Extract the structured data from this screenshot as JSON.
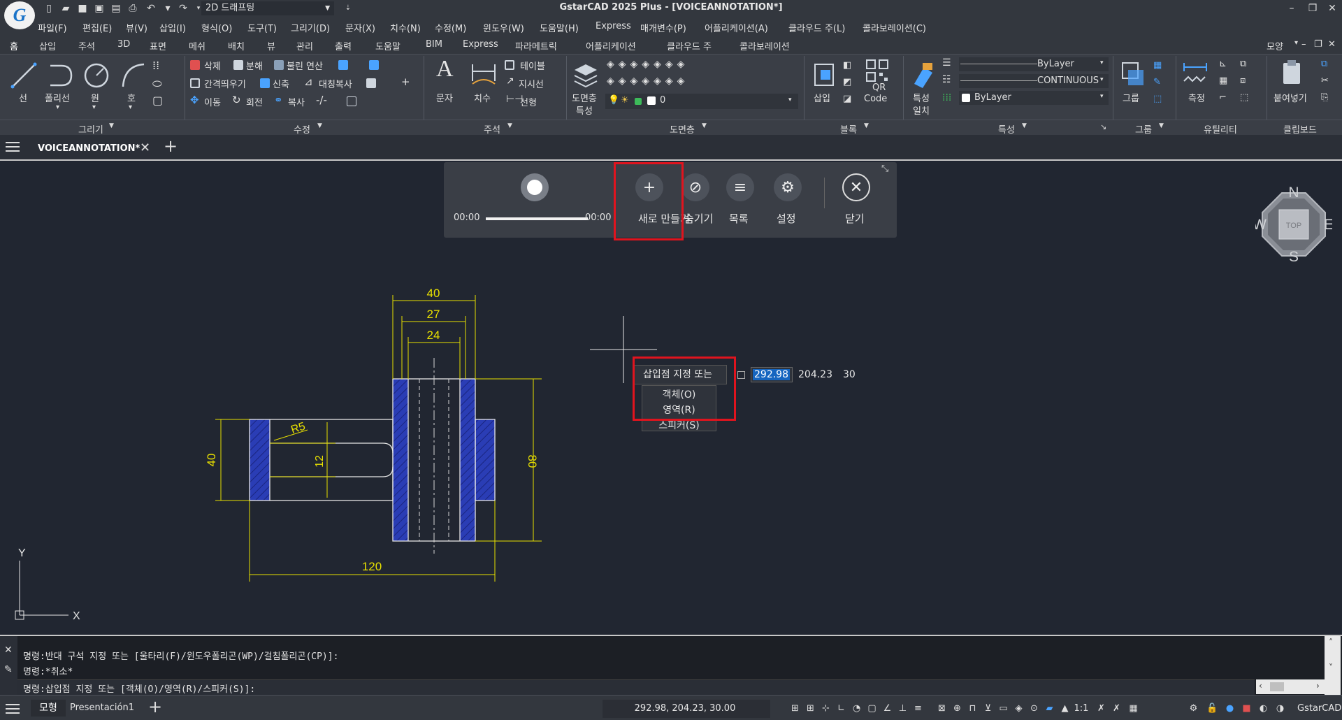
{
  "app": {
    "title": "GstarCAD 2025 Plus - [VOICEANNOTATION*]",
    "logo_letter": "G",
    "workspace": "2D 드래프팅"
  },
  "menu": [
    "파일(F)",
    "편집(E)",
    "뷰(V)",
    "삽입(I)",
    "형식(O)",
    "도구(T)",
    "그리기(D)",
    "문자(X)",
    "치수(N)",
    "수정(M)",
    "윈도우(W)",
    "도움말(H)",
    "Express",
    "매개변수(P)",
    "어플리케이션(A)",
    "클라우드 주(L)",
    "콜라보레이션(C)"
  ],
  "ribbon_tabs": [
    "홈",
    "삽입",
    "주석",
    "3D",
    "표면",
    "메쉬",
    "배치",
    "뷰",
    "관리",
    "출력",
    "도움말",
    "BIM",
    "Express",
    "파라메트릭",
    "어플리케이션",
    "클라우드 주",
    "콜라보레이션"
  ],
  "ribbon_right_label": "모양",
  "ribbon": {
    "draw": {
      "line": "선",
      "polyline": "폴리선",
      "circle": "원",
      "arc": "호",
      "panel": "그리기"
    },
    "modify": {
      "erase": "삭제",
      "explode": "분해",
      "boolean": "불린 연산",
      "offset": "간격띄우기",
      "stretch": "신축",
      "mirror": "대칭복사",
      "move": "이동",
      "rotate": "회전",
      "copy": "복사",
      "panel": "수정"
    },
    "annotation": {
      "text": "문자",
      "dimension": "치수",
      "table": "테이블",
      "leader": "지시선",
      "linear": "선형",
      "panel": "주석"
    },
    "layers": {
      "layer_props_1": "도면층",
      "layer_props_2": "특성",
      "current_layer": "0",
      "panel": "도면층"
    },
    "block": {
      "insert": "삽입",
      "qr_1": "QR",
      "qr_2": "Code",
      "panel": "블록"
    },
    "properties": {
      "match_1": "특성",
      "match_2": "일치",
      "color": "ByLayer",
      "linetype": "CONTINUOUS",
      "lineweight": "ByLayer",
      "panel": "특성"
    },
    "group": {
      "group": "그룹",
      "panel": "그룹"
    },
    "utility": {
      "measure": "측정",
      "panel": "유틸리티"
    },
    "clipboard": {
      "paste": "붙여넣기",
      "panel": "클립보드"
    }
  },
  "doc_tab": "VOICEANNOTATION*",
  "voice_panel": {
    "time_start": "00:00",
    "time_end": "00:00",
    "progress": 1.0,
    "new": "새로 만들기",
    "hide": "숨기기",
    "list": "목록",
    "settings": "설정",
    "close": "닫기"
  },
  "prompt": {
    "text": "삽입점 지정 또는",
    "x": "292.98",
    "y": "204.23",
    "z": "30",
    "options": [
      "객체(O)",
      "영역(R)",
      "스피커(S)"
    ]
  },
  "viewcube": {
    "n": "N",
    "s": "S",
    "e": "E",
    "w": "W",
    "face": "TOP"
  },
  "drawing": {
    "dims": [
      "40",
      "27",
      "24",
      "R5",
      "12",
      "80",
      "40",
      "120"
    ],
    "ucs_x": "X",
    "ucs_y": "Y"
  },
  "command_lines": [
    "명령:반대 구석 지정 또는 [울타리(F)/윈도우폴리곤(WP)/걸침폴리곤(CP)]:",
    "명령:*취소*",
    "명령:삽입점 지정 또는 [객체(O)/영역(R)/스피커(S)]:"
  ],
  "status": {
    "model_tab": "모형",
    "layout_tab": "Presentación1",
    "coords": "292.98, 204.23, 30.00",
    "scale": "1:1",
    "brand": "GstarCAD"
  },
  "colors": {
    "highlight": "#e0141e",
    "dim": "#e8e000",
    "hatch": "#2a3db5",
    "accent": "#1565c0"
  }
}
